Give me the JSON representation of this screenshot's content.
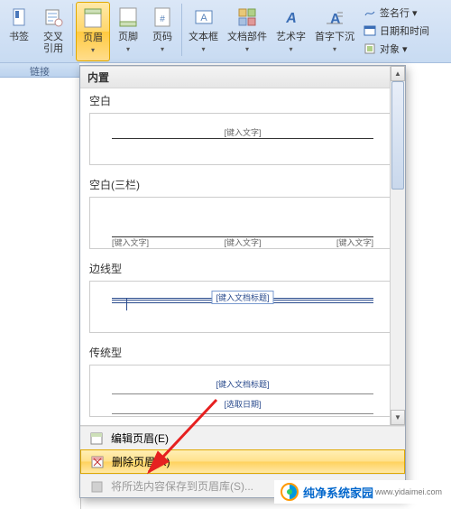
{
  "ribbon": {
    "buttons": [
      {
        "label": "书签",
        "icon": "bookmark-icon"
      },
      {
        "label": "交叉\n引用",
        "icon": "crossref-icon"
      },
      {
        "label": "页眉",
        "icon": "header-icon",
        "selected": true,
        "dropdown": true
      },
      {
        "label": "页脚",
        "icon": "footer-icon",
        "dropdown": true
      },
      {
        "label": "页码",
        "icon": "pagenum-icon",
        "dropdown": true
      },
      {
        "label": "文本框",
        "icon": "textbox-icon",
        "dropdown": true
      },
      {
        "label": "文档部件",
        "icon": "buildingblocks-icon",
        "dropdown": true
      },
      {
        "label": "艺术字",
        "icon": "wordart-icon",
        "dropdown": true
      },
      {
        "label": "首字下沉",
        "icon": "dropcap-icon",
        "dropdown": true
      }
    ],
    "mini": [
      {
        "label": "签名行 ▾",
        "icon": "signature-icon"
      },
      {
        "label": "日期和时间",
        "icon": "datetime-icon"
      },
      {
        "label": "对象 ▾",
        "icon": "object-icon"
      }
    ],
    "group_label": "链接"
  },
  "dropdown": {
    "section_title": "内置",
    "items": [
      {
        "label": "空白",
        "type": "blank",
        "placeholder": "[键入文字]"
      },
      {
        "label": "空白(三栏)",
        "type": "three",
        "placeholder": "[键入文字]"
      },
      {
        "label": "边线型",
        "type": "border",
        "placeholder": "[键入文档标题]"
      },
      {
        "label": "传统型",
        "type": "trad",
        "ph1": "[键入文档标题]",
        "ph2": "[选取日期]"
      }
    ],
    "footer": {
      "edit": "编辑页眉(E)",
      "remove": "删除页眉(R)",
      "save": "将所选内容保存到页眉库(S)..."
    }
  },
  "watermark": {
    "brand": "纯净系统家园",
    "url": "www.yidaimei.com"
  }
}
